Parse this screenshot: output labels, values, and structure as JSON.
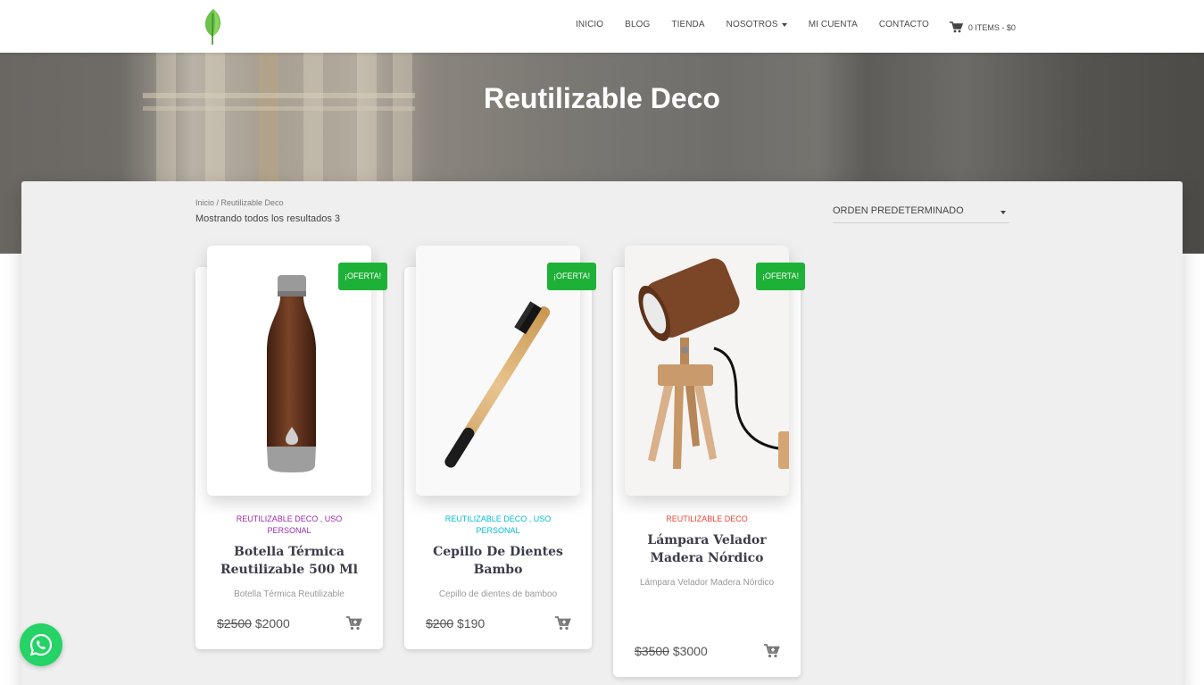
{
  "nav": {
    "items": [
      "INICIO",
      "BLOG",
      "TIENDA",
      "NOSOTROS",
      "MI CUENTA",
      "CONTACTO"
    ],
    "cart_label": "0 ITEMS - $0"
  },
  "hero": {
    "title": "Reutilizable Deco"
  },
  "shop": {
    "breadcrumb": "Inicio / Reutilizable Deco",
    "result_count": "Mostrando todos los resultados 3",
    "sort_label": "ORDEN PREDETERMINADO"
  },
  "products": [
    {
      "badge": "¡OFERTA!",
      "category": "REUTILIZABLE DECO , USO PERSONAL",
      "category_color": "#9c27b0",
      "title": "Botella Térmica Reutilizable 500 Ml",
      "description": "Botella Térmica Reutilizable",
      "old_price": "$2500",
      "price": "$2000"
    },
    {
      "badge": "¡OFERTA!",
      "category": "REUTILIZABLE DECO , USO PERSONAL",
      "category_color": "#00bcd4",
      "title": "Cepillo De Dientes Bambo",
      "description": "Cepillo de dientes de bamboo",
      "old_price": "$200",
      "price": "$190"
    },
    {
      "badge": "¡OFERTA!",
      "category": "REUTILIZABLE DECO",
      "category_color": "#f44336",
      "title": "Lámpara Velador Madera Nórdico",
      "description": "Lámpara Velador Madera Nórdico",
      "old_price": "$3500",
      "price": "$3000"
    }
  ],
  "colors": {
    "accent": "#1eb137",
    "whatsapp": "#25d366"
  }
}
